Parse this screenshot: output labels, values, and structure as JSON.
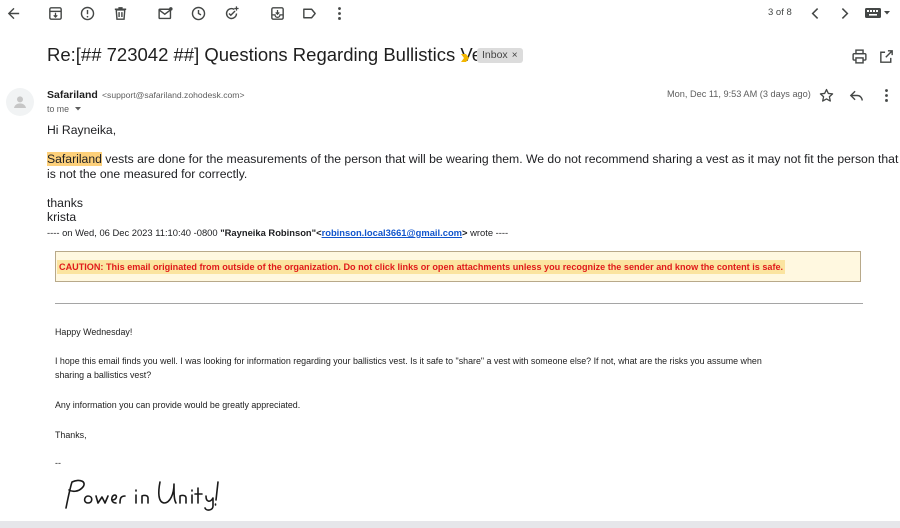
{
  "toolbar": {
    "pagination": "3 of 8",
    "icons": [
      "back-arrow-icon",
      "archive-icon",
      "report-spam-icon",
      "delete-icon",
      "mark-unread-icon",
      "snooze-icon",
      "add-task-icon",
      "move-to-icon",
      "label-icon",
      "more-vert-icon",
      "chevron-left-icon",
      "chevron-right-icon",
      "keyboard-icon"
    ]
  },
  "message": {
    "subject": "Re:[## 723042 ##] Questions Regarding Bullistics Vest",
    "label": "Inbox",
    "label_close": "×",
    "sender_name": "Safariland",
    "sender_email": "<support@safariland.zohodesk.com>",
    "to": "to me",
    "date": "Mon, Dec 11, 9:53 AM (3 days ago)",
    "greeting": "Hi Rayneika,",
    "para1_highlight": "Safariland",
    "para1_line1_rest": " vests are done for the measurements of the person that will be wearing them.  We do not recommend sharing a vest as it may not fit the person that",
    "para1_line2": "is not the one measured for correctly.",
    "signoff": "thanks",
    "signname": "krista",
    "quote_prefix": "---- on Wed, 06 Dec 2023 11:10:40 -0800 ",
    "quote_name": "\"Rayneika Robinson\"<",
    "quote_email": "robinson.local3661@gmail.com",
    "quote_suffix": "> wrote ----",
    "caution": "CAUTION: This email originated from outside of the organization. Do not click links or open attachments unless you recognize the sender and know the content is safe.",
    "quoted": {
      "greeting": "Happy Wednesday!",
      "para_line1": "I hope this email finds you well. I was looking for information regarding your ballistics vest. Is it safe to \"share\" a vest with someone else? If not, what are the risks you assume when",
      "para_line2": "sharing a ballistics vest?",
      "para2": "Any information you can provide would be greatly appreciated.",
      "thanks": "Thanks,",
      "dash": "--",
      "signature": "Power in Unity!"
    }
  },
  "colors": {
    "highlight": "#fdd07a",
    "caution_text": "#e01a1a",
    "link": "#1155cc"
  }
}
